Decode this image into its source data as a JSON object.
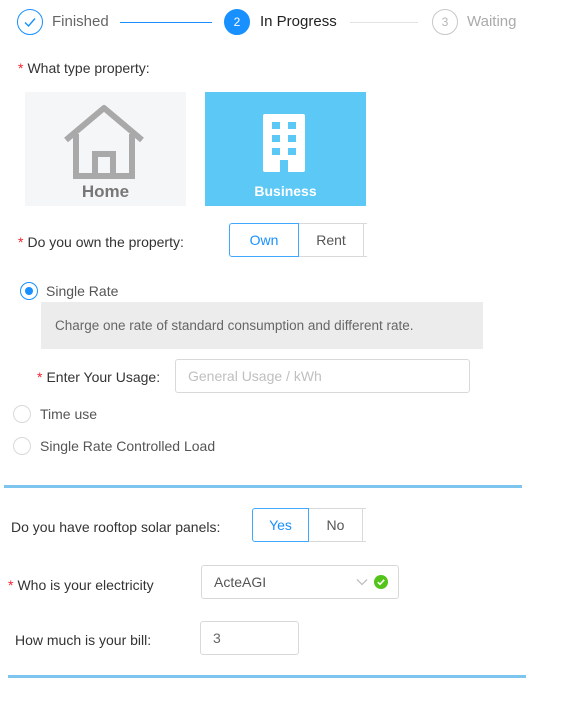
{
  "steps": [
    {
      "label": "Finished",
      "icon": "check-icon",
      "status": "finished"
    },
    {
      "label": "In Progress",
      "number": "2",
      "status": "in-progress"
    },
    {
      "label": "Waiting",
      "number": "3",
      "status": "waiting"
    }
  ],
  "property_type": {
    "label": "What type property",
    "suffix": ":",
    "options": [
      {
        "label": "Home",
        "icon": "house-icon",
        "selected": false
      },
      {
        "label": "Business",
        "icon": "building-icon",
        "selected": true
      }
    ]
  },
  "own_property": {
    "label": "Do you own the property",
    "suffix": ":",
    "options": [
      "Own",
      "Rent"
    ],
    "selected": "Own"
  },
  "rate_options": {
    "single_rate": {
      "label": "Single Rate",
      "checked": true
    },
    "note": "Charge one rate of standard consumption and different rate.",
    "usage": {
      "label": "Enter Your Usage",
      "suffix": ":",
      "placeholder": "General Usage / kWh",
      "value": ""
    },
    "time_use": {
      "label": "Time use",
      "checked": false
    },
    "controlled_load": {
      "label": "Single Rate Controlled Load",
      "checked": false
    }
  },
  "solar": {
    "label": "Do you have rooftop solar panels",
    "suffix": ":",
    "options": [
      "Yes",
      "No"
    ],
    "selected": "Yes"
  },
  "electricity": {
    "label": "Who is your electricity",
    "value": "ActeAGI",
    "valid": true
  },
  "bill": {
    "label": "How much is your bill",
    "suffix": ":",
    "value": "3"
  },
  "colors": {
    "primary": "#1890ff",
    "business_card": "#5bc8f5",
    "home_card": "#f5f6f8",
    "divider": "#7dc5ee",
    "success": "#52c41a",
    "required": "#f5222d"
  }
}
